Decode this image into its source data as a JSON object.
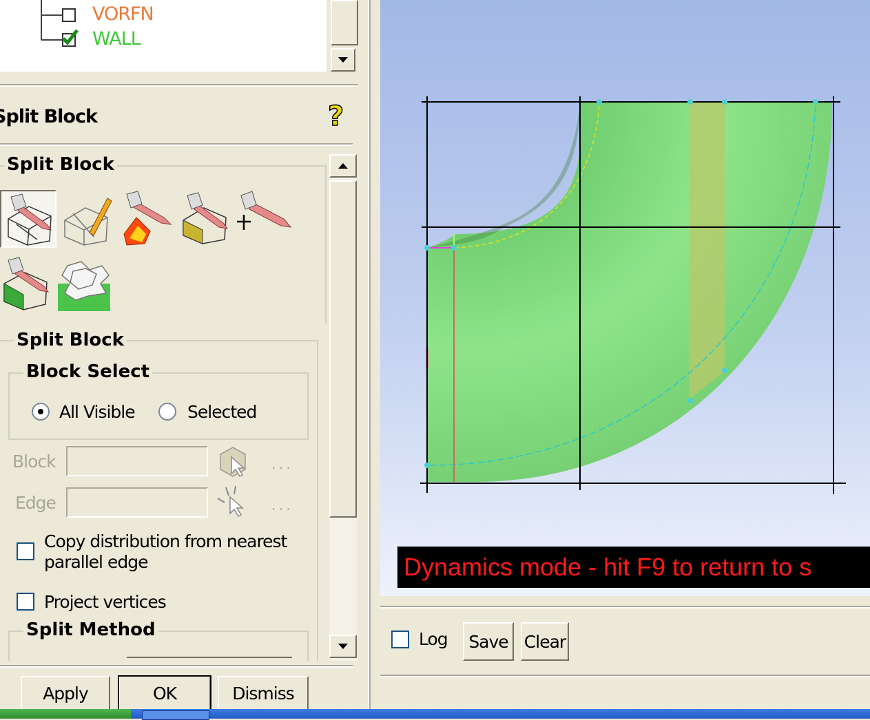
{
  "tree": {
    "items": [
      {
        "label": "VORFN",
        "color": "#e87a3a",
        "checked": false
      },
      {
        "label": "WALL",
        "color": "#42c83a",
        "checked": true
      }
    ]
  },
  "panel": {
    "title": "Split Block",
    "tools_group_title": "Split Block",
    "split_group_title": "Split Block",
    "block_select": {
      "title": "Block Select",
      "options": [
        {
          "label": "All Visible",
          "selected": true
        },
        {
          "label": "Selected",
          "selected": false
        }
      ]
    },
    "block_label": "Block",
    "block_value": "",
    "block_dots": ". . .",
    "edge_label": "Edge",
    "edge_value": "",
    "edge_dots": ". . .",
    "copy_distribution_label_1": "Copy distribution from nearest",
    "copy_distribution_label_2": "parallel edge",
    "copy_distribution_checked": false,
    "project_vertices_label": "Project vertices",
    "project_vertices_checked": false,
    "split_method_title": "Split Method"
  },
  "buttons": {
    "apply": "Apply",
    "ok": "OK",
    "dismiss": "Dismiss"
  },
  "viewport": {
    "banner": "Dynamics mode - hit F9 to return to s"
  },
  "log_bar": {
    "log_label": "Log",
    "log_checked": false,
    "save": "Save",
    "clear": "Clear"
  },
  "colors": {
    "pipe_green": "#8ee07a",
    "banner_text": "#ff1a1a"
  }
}
